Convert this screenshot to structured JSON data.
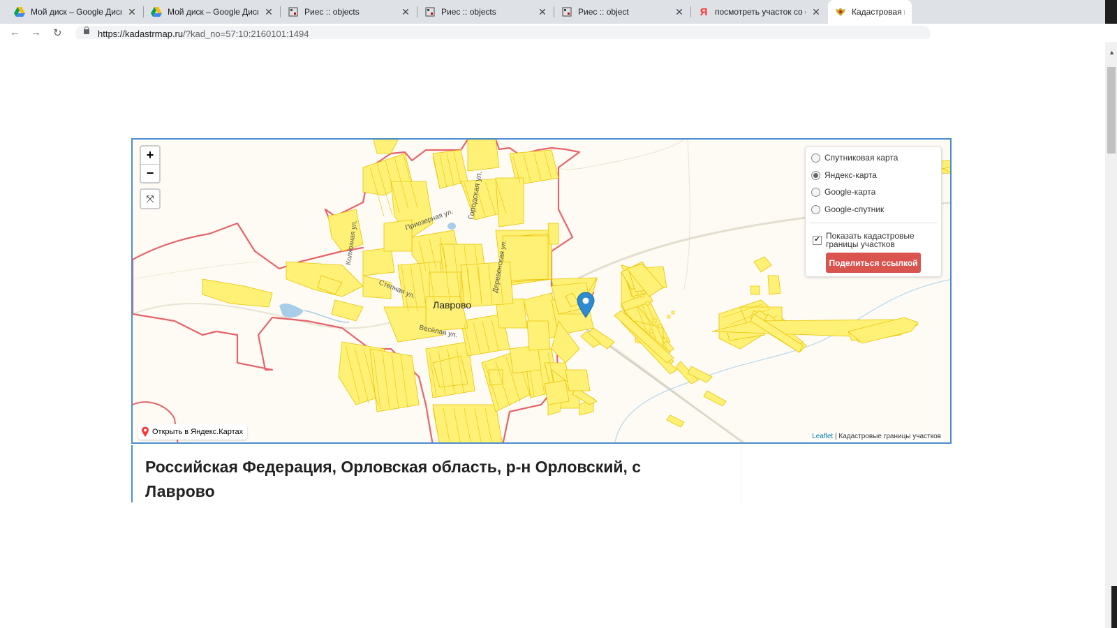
{
  "browser": {
    "tabs": [
      {
        "title": "Мой диск – Google Диск",
        "icon": "google-drive-icon"
      },
      {
        "title": "Мой диск – Google Диск",
        "icon": "google-drive-icon"
      },
      {
        "title": "Риес :: objects",
        "icon": "ries-icon"
      },
      {
        "title": "Риес :: objects",
        "icon": "ries-icon"
      },
      {
        "title": "Риес :: object",
        "icon": "ries-icon"
      },
      {
        "title": "посмотреть участок со с",
        "icon": "yandex-icon"
      },
      {
        "title": "Кадастровая пуб",
        "icon": "rosreestr-emblem-icon"
      }
    ],
    "url_host": "https://kadastrmap.ru",
    "url_rest": "/?kad_no=57:10:2160101:1494"
  },
  "map": {
    "zoom_in": "+",
    "zoom_out": "−",
    "fullscreen_icon": "fullscreen-icon",
    "locality_label": "Лаврово",
    "streets": [
      "Колхозная ул.",
      "Приозерная ул.",
      "Городская ул.",
      "Деревенская ул.",
      "Степная ул.",
      "Весёлая ул."
    ],
    "layers": {
      "options": [
        "Спутниковая карта",
        "Яндекс-карта",
        "Google-карта",
        "Google-спутник"
      ],
      "selected_index": 1,
      "show_boundaries_label": "Показать кадастровые границы участков",
      "show_boundaries_checked": true,
      "share_button": "Поделиться ссылкой"
    },
    "open_yandex": "Открыть в Яндекс.Картах",
    "attribution_leaflet": "Leaflet",
    "attribution_sep": " | ",
    "attribution_rest": "Кадастровые границы участков",
    "colors": {
      "parcel_fill": "#fff176",
      "parcel_stroke": "#e8c300",
      "boundary": "#e5646b",
      "frame": "#4c8ed1",
      "share_button": "#d9534f"
    }
  },
  "address": "Российская Федерация, Орловская область, р-н Орловский, с Лаврово"
}
